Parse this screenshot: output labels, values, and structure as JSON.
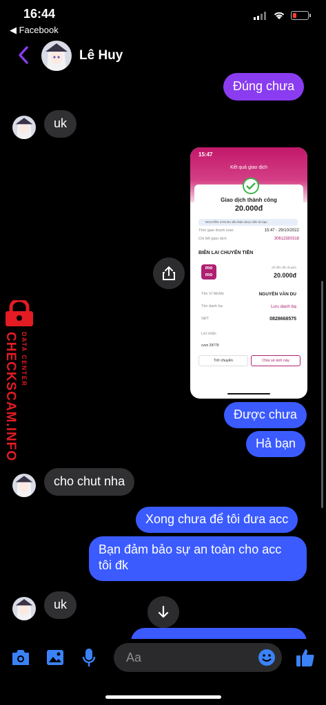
{
  "status": {
    "time": "16:44",
    "back_app": "◀ Facebook"
  },
  "header": {
    "contact_name": "Lê Huy"
  },
  "messages": {
    "m1": "Đúng chưa",
    "m2": "uk",
    "m3": "Được chưa",
    "m4": "Hả bạn",
    "m5": "cho chut nha",
    "m6": "Xong chưa để tôi đưa acc",
    "m7": "Bạn đảm bảo sự an toàn cho acc tôi đk",
    "m8": "uk"
  },
  "receipt": {
    "time": "15:47",
    "title": "Kết quả giao dịch",
    "status": "Giao dịch thành công",
    "amount": "20.000đ",
    "notice": "NGUYỄN VĂN DU đã nhận được tiền từ bạn",
    "pay_time_label": "Thời gian thanh toán",
    "pay_time": "15:47 - 29/10/2022",
    "detail_label": "Chi tiết giao dịch",
    "detail_value": "30611580318",
    "section": "BIÊN LAI CHUYỂN TIỀN",
    "momo_top": "mo",
    "momo_bottom": "mo",
    "sent_label": "Số tiền đã chuyển",
    "sent_value": "20.000đ",
    "wallet_label": "Tên Ví MoMo",
    "wallet_value": "NGUYỄN VĂN DU",
    "contact_label": "Tên danh bạ",
    "contact_value": "Lưu danh bạ",
    "phone_label": "SĐT",
    "phone_value": "0828668575",
    "note_label": "Lời nhắn",
    "note_value": "cvvn 29779",
    "btn_transfer": "Trở chuyển",
    "btn_share": "Chia sẻ ảnh này"
  },
  "watermark": {
    "small": "DATA CENTER",
    "big": "CHECKSCAM.INFO"
  },
  "composer": {
    "placeholder": "Aa"
  },
  "colors": {
    "sent": "#3b5bff",
    "sent_purple": "#8a3cf0",
    "received": "#303032",
    "accent": "#8a3cf0",
    "momo": "#ae2070"
  }
}
